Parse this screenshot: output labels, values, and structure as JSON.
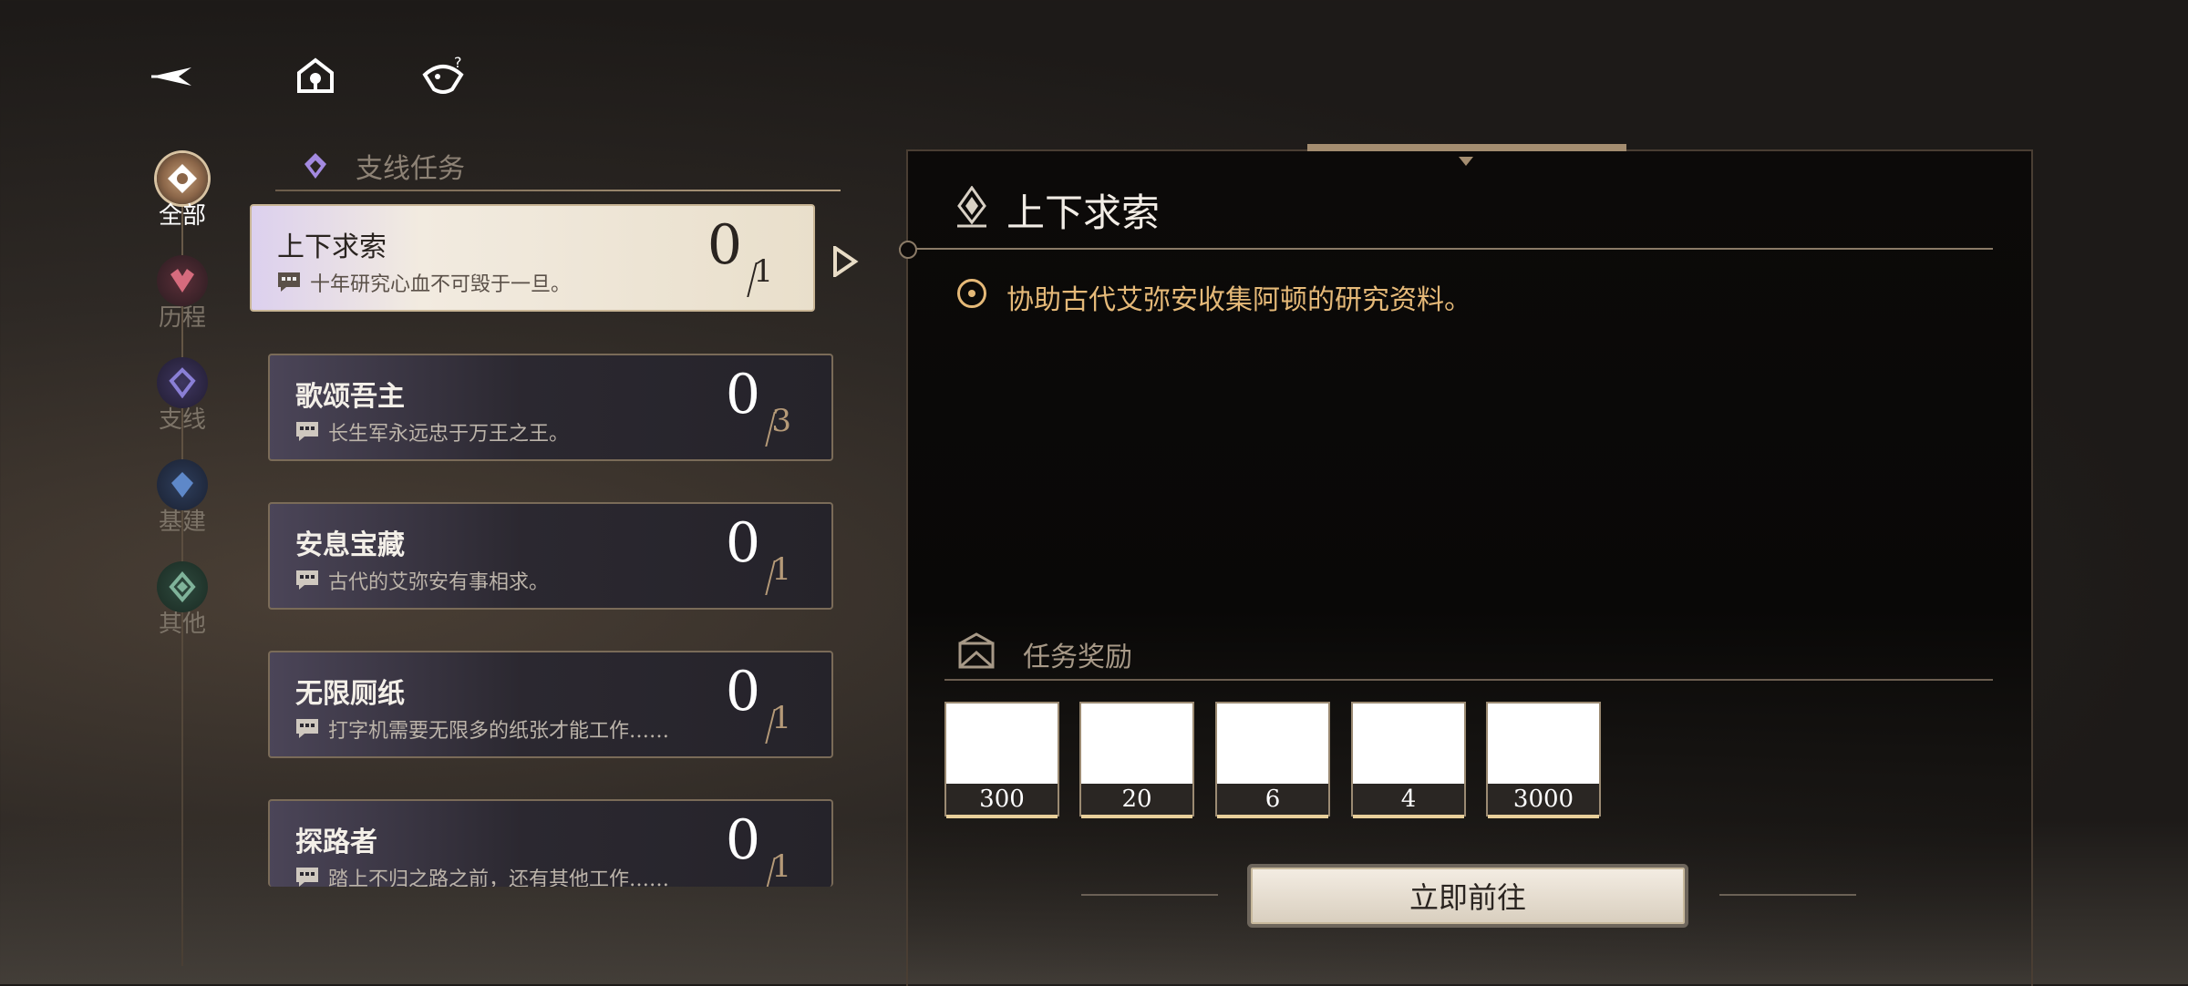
{
  "topbar": {
    "back_icon": "back-arrow-icon",
    "home_icon": "home-icon",
    "help_icon": "help-mascot-icon"
  },
  "categories": [
    {
      "label": "全部",
      "color": "#e0b887"
    },
    {
      "label": "历程",
      "color": "#d66b7d"
    },
    {
      "label": "支线",
      "color": "#8a7fd6"
    },
    {
      "label": "基建",
      "color": "#5e88c9"
    },
    {
      "label": "其他",
      "color": "#7fb39a"
    }
  ],
  "list": {
    "header": "支线任务",
    "quests": [
      {
        "title": "上下求索",
        "desc": "十年研究心血不可毁于一旦。",
        "current": "0",
        "total": "1"
      },
      {
        "title": "歌颂吾主",
        "desc": "长生军永远忠于万王之王。",
        "current": "0",
        "total": "3"
      },
      {
        "title": "安息宝藏",
        "desc": "古代的艾弥安有事相求。",
        "current": "0",
        "total": "1"
      },
      {
        "title": "无限厕纸",
        "desc": "打字机需要无限多的纸张才能工作……",
        "current": "0",
        "total": "1"
      },
      {
        "title": "探路者",
        "desc": "踏上不归之路之前，还有其他工作……",
        "current": "0",
        "total": "1"
      }
    ]
  },
  "detail": {
    "title": "上下求索",
    "objective": "协助古代艾弥安收集阿顿的研究资料。",
    "rewards_title": "任务奖励",
    "rewards": [
      "300",
      "20",
      "6",
      "4",
      "3000"
    ],
    "go_button": "立即前往"
  },
  "accent": "#e5b978"
}
